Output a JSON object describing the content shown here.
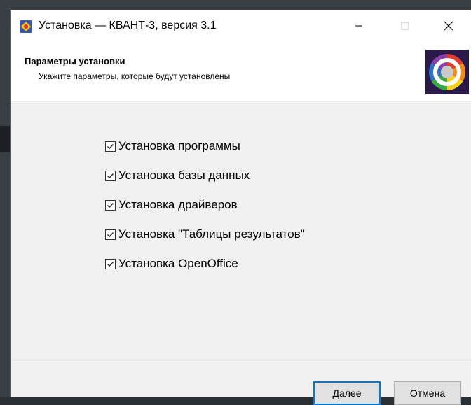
{
  "window": {
    "title": "Установка — КВАНТ-3, версия 3.1"
  },
  "header": {
    "title": "Параметры установки",
    "subtitle": "Укажите параметры, которые будут установлены"
  },
  "options": [
    {
      "label": "Установка программы",
      "checked": true
    },
    {
      "label": "Установка базы данных",
      "checked": true
    },
    {
      "label": "Установка драйверов",
      "checked": true
    },
    {
      "label": "Установка \"Таблицы результатов\"",
      "checked": true
    },
    {
      "label": "Установка OpenOffice",
      "checked": true
    }
  ],
  "buttons": {
    "next_label": "Далее",
    "cancel_label": "Отмена"
  },
  "colors": {
    "accent": "#0078d7",
    "window_bg": "#f0f0f0"
  }
}
